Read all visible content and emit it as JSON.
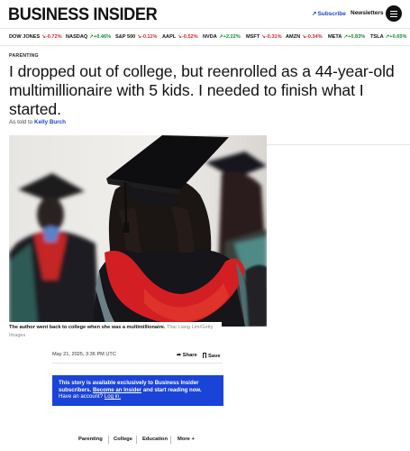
{
  "header": {
    "logo": "BUSINESS INSIDER",
    "subscribe_label": "Subscribe",
    "newsletters_label": "Newsletters"
  },
  "tickers": [
    {
      "symbol": "DOW JONES",
      "change": "-0.72%",
      "direction": "down"
    },
    {
      "symbol": "NASDAQ",
      "change": "+0.46%",
      "direction": "up"
    },
    {
      "symbol": "S&P 500",
      "change": "-0.11%",
      "direction": "down"
    },
    {
      "symbol": "AAPL",
      "change": "-0.52%",
      "direction": "down"
    },
    {
      "symbol": "NVDA",
      "change": "+2.22%",
      "direction": "up"
    },
    {
      "symbol": "MSFT",
      "change": "-0.31%",
      "direction": "down"
    },
    {
      "symbol": "AMZN",
      "change": "-0.34%",
      "direction": "down"
    },
    {
      "symbol": "META",
      "change": "+0.83%",
      "direction": "up"
    },
    {
      "symbol": "TSLA",
      "change": "+0.65%",
      "direction": "up"
    }
  ],
  "colors": {
    "negative": "#d3262e",
    "positive": "#118a2e",
    "accent": "#1a44d8"
  },
  "article": {
    "category": "PARENTING",
    "headline": "I dropped out of college, but reenrolled as a 44-year-old multimillionaire with 5 kids. I needed to finish what I started.",
    "byline_prefix": "As told to",
    "byline_author": "Kelly Burch",
    "image_caption": "The author went back to college when she was a multimillionaire.",
    "image_credit": "Thai Liang Lim/Getty Images",
    "date": "May 21, 2025, 3:36 PM UTC",
    "share_label": "Share",
    "save_label": "Save"
  },
  "paywall": {
    "line1": "This story is available exclusively to Business Insider subscribers.",
    "become_insider": "Become an Insider",
    "line2": "and start reading now.",
    "have_account": "Have an account?",
    "login": "Log in."
  },
  "tags": [
    {
      "label": "Parenting"
    },
    {
      "label": "College"
    },
    {
      "label": "Education"
    },
    {
      "label": "More"
    }
  ]
}
